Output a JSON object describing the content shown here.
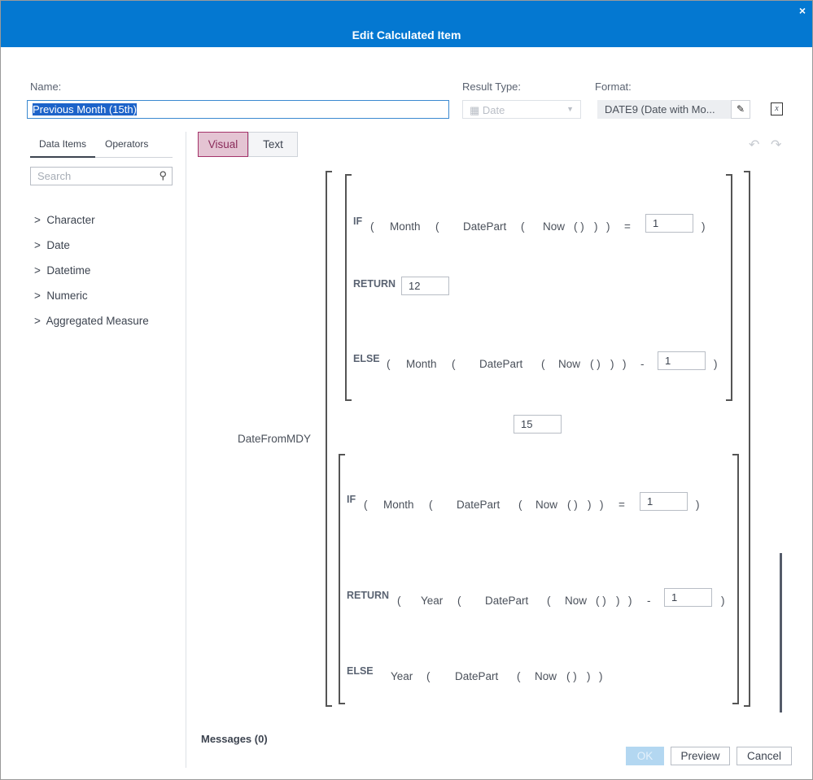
{
  "dialog": {
    "title": "Edit Calculated Item",
    "close_icon": "×"
  },
  "name": {
    "label": "Name:",
    "value": "Previous Month (15th)"
  },
  "result_type": {
    "label": "Result Type:",
    "value": "Date"
  },
  "format": {
    "label": "Format:",
    "value": "DATE9 (Date with Mo..."
  },
  "left_tabs": [
    "Data Items",
    "Operators"
  ],
  "search": {
    "placeholder": "Search"
  },
  "tree": [
    "Character",
    "Date",
    "Datetime",
    "Numeric",
    "Aggregated Measure"
  ],
  "mode_tabs": {
    "visual": "Visual",
    "text": "Text",
    "active": "Visual"
  },
  "expression": {
    "function": "DateFromMDY",
    "day_value": "15",
    "month_block": {
      "if": [
        "IF",
        "(",
        "Month",
        "(",
        "DatePart",
        "(",
        "Now",
        "( )",
        ")",
        ")",
        "=",
        "1",
        ")"
      ],
      "return": [
        "RETURN",
        "12"
      ],
      "else": [
        "ELSE",
        "(",
        "Month",
        "(",
        "DatePart",
        "(",
        "Now",
        "( )",
        ")",
        ")",
        "-",
        "1",
        ")"
      ]
    },
    "year_block": {
      "if": [
        "IF",
        "(",
        "Month",
        "(",
        "DatePart",
        "(",
        "Now",
        "( )",
        ")",
        ")",
        "=",
        "1",
        ")"
      ],
      "return": [
        "RETURN",
        "(",
        "Year",
        "(",
        "DatePart",
        "(",
        "Now",
        "( )",
        ")",
        ")",
        "-",
        "1",
        ")"
      ],
      "else": [
        "ELSE",
        "Year",
        "(",
        "DatePart",
        "(",
        "Now",
        "( )",
        ")",
        ")"
      ]
    }
  },
  "messages": "Messages (0)",
  "buttons": {
    "ok": "OK",
    "preview": "Preview",
    "cancel": "Cancel"
  },
  "colors": {
    "titlebar": "#0478d1",
    "visual_tab": "#e4c4d3"
  }
}
